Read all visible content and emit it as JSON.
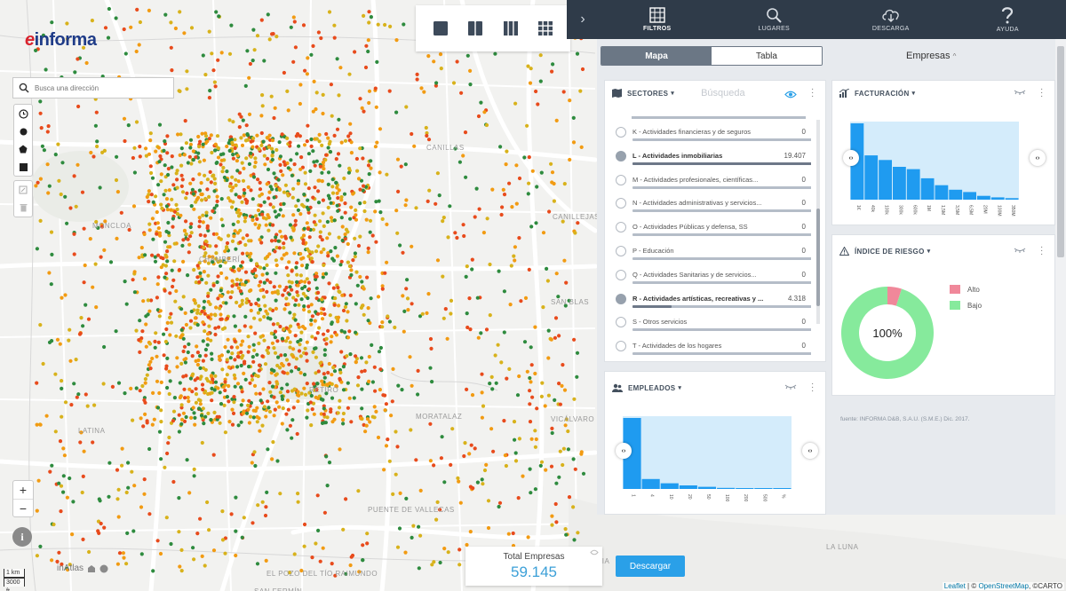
{
  "brand": {
    "logo_e": "e",
    "logo_rest": "informa"
  },
  "map": {
    "search_placeholder": "Busca una dirección",
    "labels": [
      {
        "t": "MONCLOA"
      },
      {
        "t": "CHAMBERÍ"
      },
      {
        "t": "CANILLAS"
      },
      {
        "t": "LATINA"
      },
      {
        "t": "RETIRO"
      },
      {
        "t": "MORATALAZ"
      },
      {
        "t": "VICÁLVARO"
      },
      {
        "t": "PUENTE DE VALLECAS"
      },
      {
        "t": "SAN BLAS"
      },
      {
        "t": "CANILLEJAS"
      },
      {
        "t": "LA LUNA"
      },
      {
        "t": "SANTA EUGENIA"
      },
      {
        "t": "EL POZO DEL TÍO RAIMUNDO"
      },
      {
        "t": "SAN FERMÍN"
      }
    ],
    "scale_km": "1 km",
    "scale_ft": "3000 ft",
    "made_by": "inAtlas",
    "zoom_in": "+",
    "zoom_out": "−",
    "info": "i",
    "dot_colors": [
      "#e84b1c",
      "#f29b12",
      "#2e8b3e",
      "#d8b21b"
    ]
  },
  "layout_icons": [
    "single-layout-icon",
    "two-column-layout-icon",
    "three-column-layout-icon",
    "grid-layout-icon"
  ],
  "nav": {
    "items": [
      {
        "label": "FILTROS",
        "icon": "filter-map-icon",
        "active": true
      },
      {
        "label": "LUGARES",
        "icon": "search-icon",
        "active": false
      },
      {
        "label": "DESCARGA",
        "icon": "cloud-download-icon",
        "active": false
      },
      {
        "label": "AYUDA",
        "icon": "help-icon",
        "active": false
      }
    ]
  },
  "view_tabs": {
    "map": "Mapa",
    "table": "Tabla",
    "active": "Mapa"
  },
  "entity_selector": "Empresas",
  "sectores": {
    "title": "SECTORES",
    "search_placeholder": "Búsqueda",
    "rows": [
      {
        "label": "K - Actividades financieras y de seguros",
        "count": "0",
        "checked": false,
        "fill": 0
      },
      {
        "label": "L - Actividades inmobiliarias",
        "count": "19.407",
        "checked": true,
        "fill": 1.0
      },
      {
        "label": "M - Actividades profesionales, científicas...",
        "count": "0",
        "checked": false,
        "fill": 0
      },
      {
        "label": "N - Actividades administrativas y servicios...",
        "count": "0",
        "checked": false,
        "fill": 0
      },
      {
        "label": "O - Actividades Públicas y defensa, SS",
        "count": "0",
        "checked": false,
        "fill": 0
      },
      {
        "label": "P - Educación",
        "count": "0",
        "checked": false,
        "fill": 0
      },
      {
        "label": "Q - Actividades Sanitarias y de servicios...",
        "count": "0",
        "checked": false,
        "fill": 0
      },
      {
        "label": "R - Actividades artísticas, recreativas y ...",
        "count": "4.318",
        "checked": true,
        "fill": 0.22
      },
      {
        "label": "S - Otros servicios",
        "count": "0",
        "checked": false,
        "fill": 0
      },
      {
        "label": "T - Actividades de los hogares",
        "count": "0",
        "checked": false,
        "fill": 0
      }
    ]
  },
  "facturacion": {
    "title": "FACTURACIÓN",
    "categories": [
      "1€",
      "40k",
      "100k",
      "300k",
      "600k",
      "1M",
      "1,5M",
      "3,5M",
      "6,5M",
      "20M",
      "100M",
      "350M"
    ],
    "values": [
      100,
      58,
      52,
      43,
      40,
      28,
      19,
      13,
      10,
      5,
      3,
      2
    ]
  },
  "riesgo": {
    "title": "ÍNDICE DE RIESGO",
    "center_label": "100%",
    "slices": [
      {
        "name": "Alto",
        "value": 5,
        "color": "#f0889a"
      },
      {
        "name": "Bajo",
        "value": 95,
        "color": "#86ea9c"
      }
    ]
  },
  "empleados": {
    "title": "EMPLEADOS",
    "categories": [
      "1",
      "4",
      "10",
      "20",
      "50",
      "100",
      "200",
      "500",
      "%"
    ],
    "values": [
      100,
      14,
      8,
      5,
      3,
      1.5,
      1,
      0.5,
      0.3
    ]
  },
  "source": "fuente: INFORMA D&B, S.A.U. (S.M.E.) Dic. 2017.",
  "total": {
    "label": "Total Empresas",
    "value": "59.145"
  },
  "download_button": "Descargar",
  "attribution": {
    "leaflet": "Leaflet",
    "sep": " | © ",
    "osm": "OpenStreetMap",
    "carto": ", ©CARTO"
  }
}
